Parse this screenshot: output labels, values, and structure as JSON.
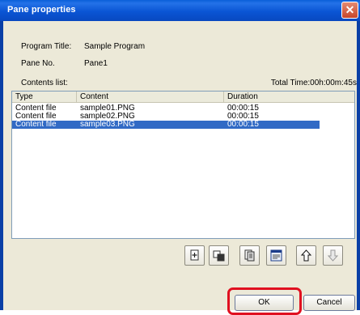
{
  "window": {
    "title": "Pane properties"
  },
  "fields": {
    "program_title_label": "Program Title:",
    "program_title_value": "Sample Program",
    "pane_no_label": "Pane No.",
    "pane_no_value": "Pane1",
    "contents_list_label": "Contents list:",
    "total_time": "Total Time:00h:00m:45s"
  },
  "table": {
    "columns": [
      "Type",
      "Content",
      "Duration"
    ],
    "rows": [
      {
        "type": "Content file",
        "content": "sample01.PNG",
        "duration": "00:00:15",
        "selected": false
      },
      {
        "type": "Content file",
        "content": "sample02.PNG",
        "duration": "00:00:15",
        "selected": false
      },
      {
        "type": "Content file",
        "content": "sample03.PNG",
        "duration": "00:00:15",
        "selected": true
      }
    ]
  },
  "toolbar": {
    "icons": [
      "add-content-icon",
      "edit-content-icon",
      "copy-content-icon",
      "properties-icon",
      "up-arrow-icon",
      "down-arrow-icon"
    ]
  },
  "buttons": {
    "ok_label": "OK",
    "cancel_label": "Cancel"
  },
  "colors": {
    "selection": "#316ac5",
    "highlight": "#e01020",
    "titlebar": "#0a55d4"
  }
}
